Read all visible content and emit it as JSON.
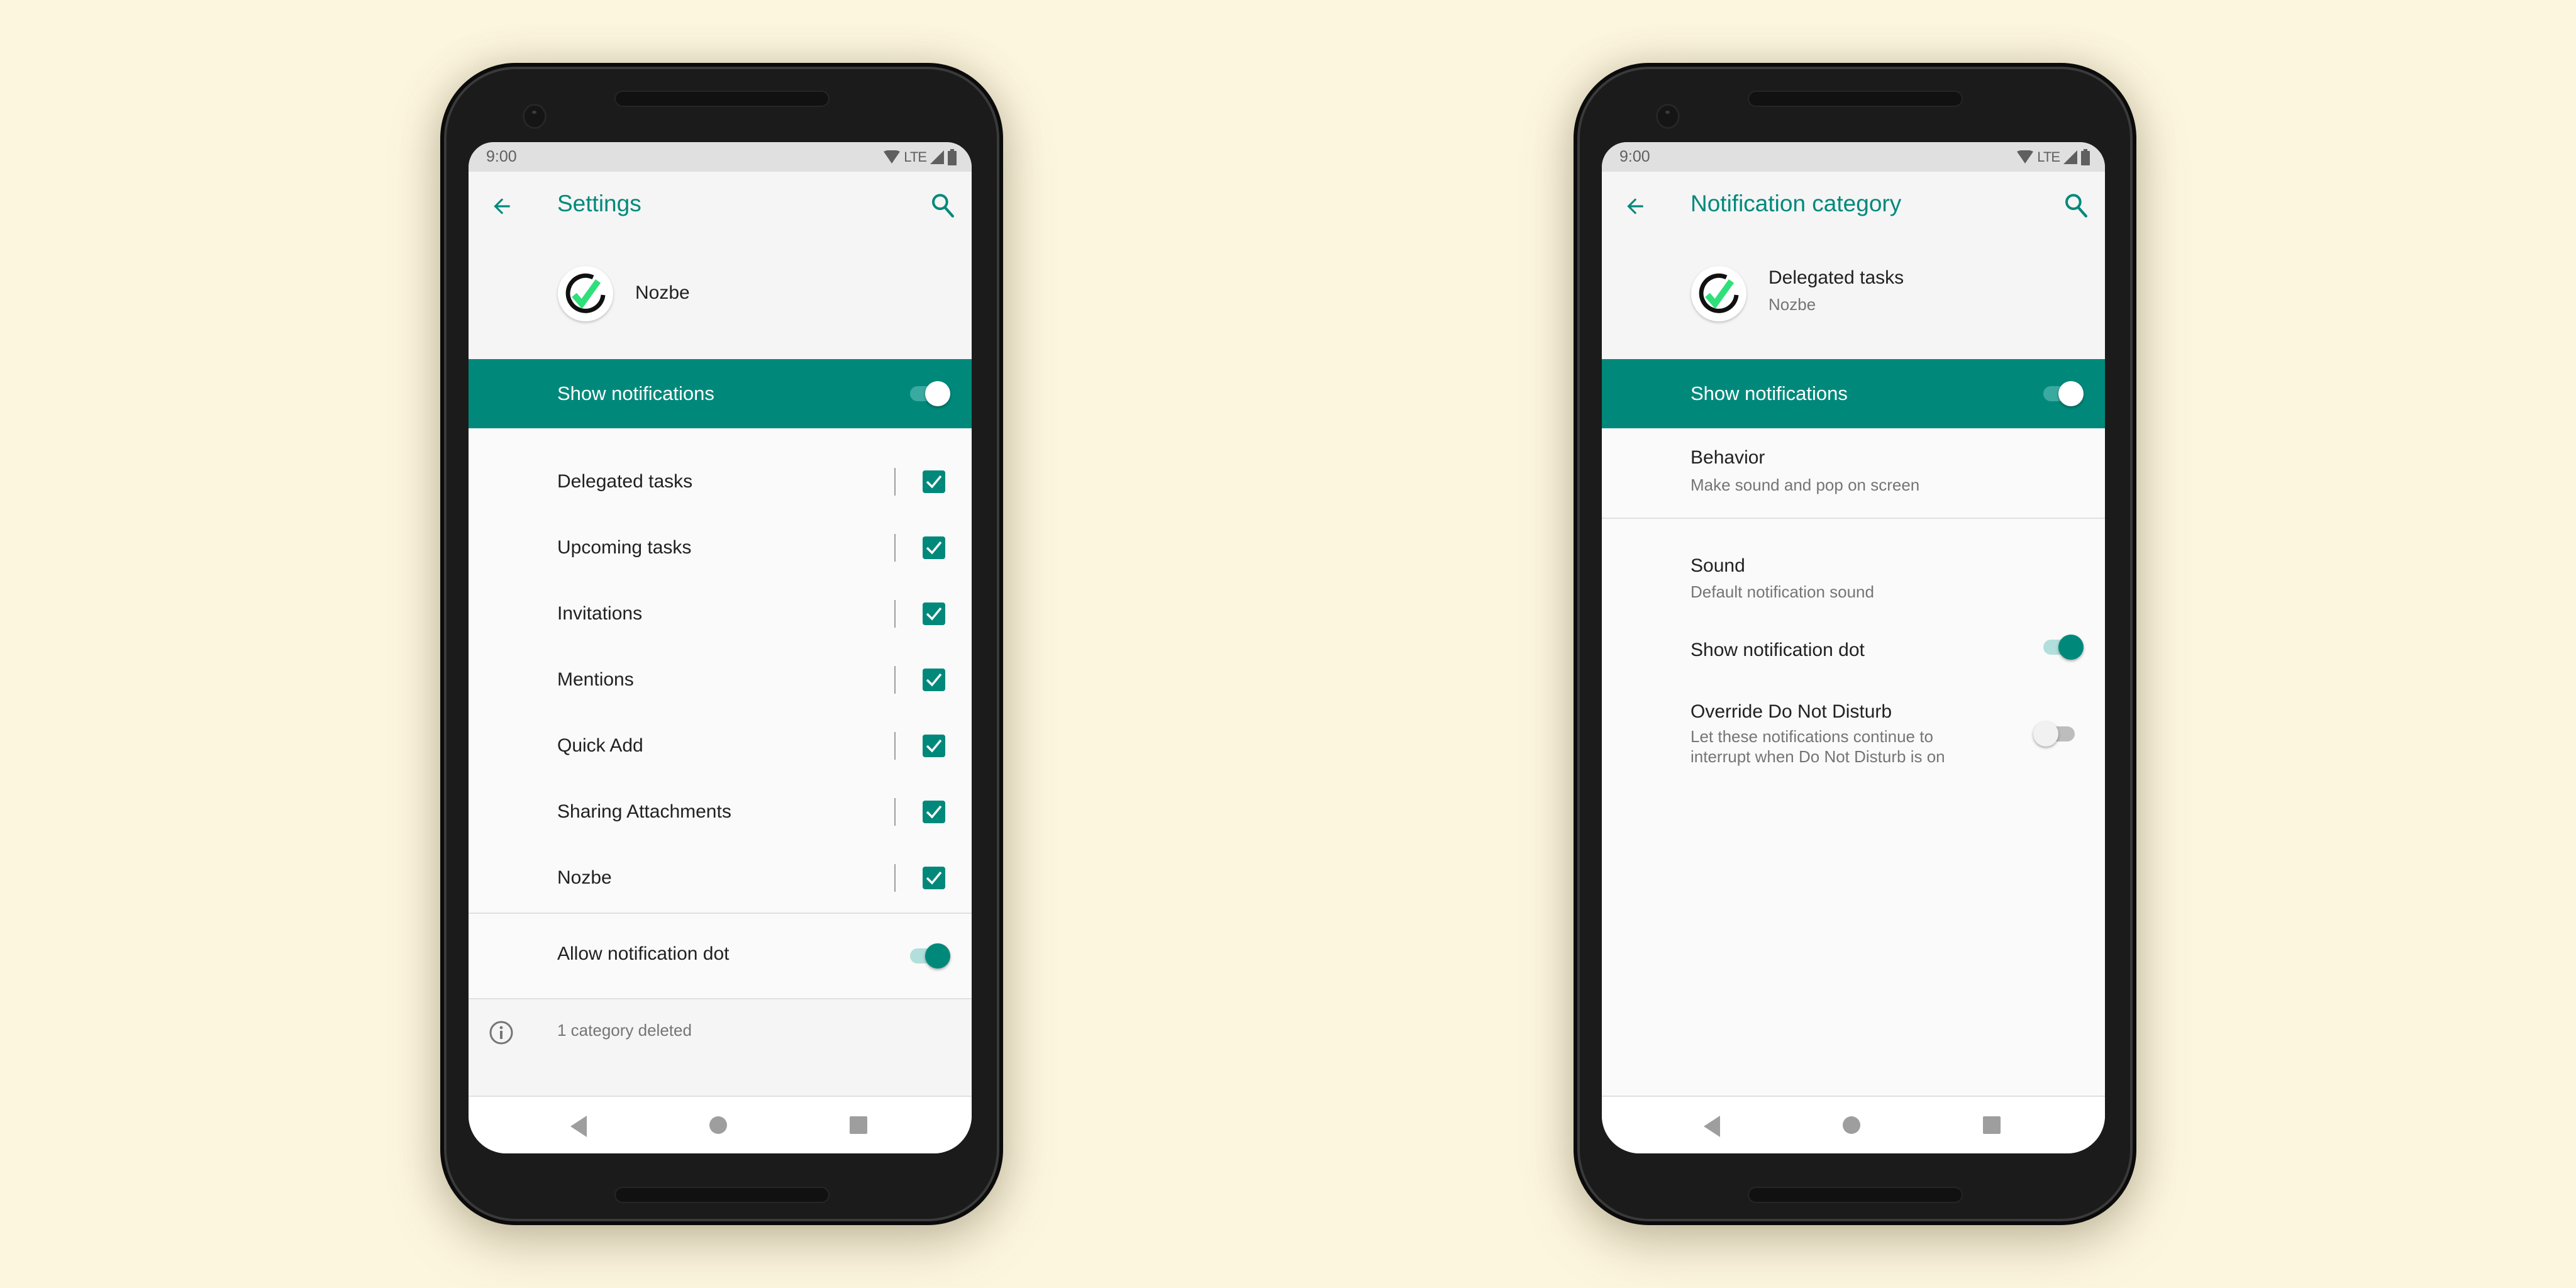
{
  "colors": {
    "accent": "#00897b",
    "background": "#fdf6df",
    "status_bar": "#e0e0e0",
    "switch_track_on": "#b2dfdb",
    "switch_off_track": "#bdbdbd"
  },
  "left_screen": {
    "status_bar": {
      "time": "9:00",
      "network": "LTE",
      "icons": [
        "wifi-icon",
        "signal-icon",
        "battery-icon"
      ]
    },
    "app_bar": {
      "title": "Settings",
      "back_icon": "arrow-back-icon",
      "search_icon": "search-icon"
    },
    "app_header": {
      "app_name": "Nozbe",
      "icon": "nozbe-logo-icon"
    },
    "master_toggle": {
      "label": "Show notifications",
      "checked": true
    },
    "categories": [
      {
        "label": "Delegated tasks",
        "checked": true
      },
      {
        "label": "Upcoming tasks",
        "checked": true
      },
      {
        "label": "Invitations",
        "checked": true
      },
      {
        "label": "Mentions",
        "checked": true
      },
      {
        "label": "Quick Add",
        "checked": true
      },
      {
        "label": "Sharing Attachments",
        "checked": true
      },
      {
        "label": "Nozbe",
        "checked": true
      }
    ],
    "notification_dot": {
      "label": "Allow notification dot",
      "checked": true
    },
    "footer_info": {
      "icon": "info-icon",
      "text": "1 category deleted"
    },
    "nav_bar": {
      "buttons": [
        "back-triangle-icon",
        "home-circle-icon",
        "recents-square-icon"
      ]
    }
  },
  "right_screen": {
    "status_bar": {
      "time": "9:00",
      "network": "LTE",
      "icons": [
        "wifi-icon",
        "signal-icon",
        "battery-icon"
      ]
    },
    "app_bar": {
      "title": "Notification category",
      "back_icon": "arrow-back-icon",
      "search_icon": "search-icon"
    },
    "app_header": {
      "title": "Delegated tasks",
      "subtitle": "Nozbe",
      "icon": "nozbe-logo-icon"
    },
    "master_toggle": {
      "label": "Show notifications",
      "checked": true
    },
    "behavior": {
      "title": "Behavior",
      "summary": "Make sound and pop on screen"
    },
    "sound": {
      "title": "Sound",
      "summary": "Default notification sound"
    },
    "notification_dot": {
      "label": "Show notification dot",
      "checked": true
    },
    "override_dnd": {
      "title": "Override Do Not Disturb",
      "summary_line1": "Let these notifications continue to",
      "summary_line2": "interrupt when Do Not Disturb is on",
      "checked": false
    },
    "nav_bar": {
      "buttons": [
        "back-triangle-icon",
        "home-circle-icon",
        "recents-square-icon"
      ]
    }
  }
}
